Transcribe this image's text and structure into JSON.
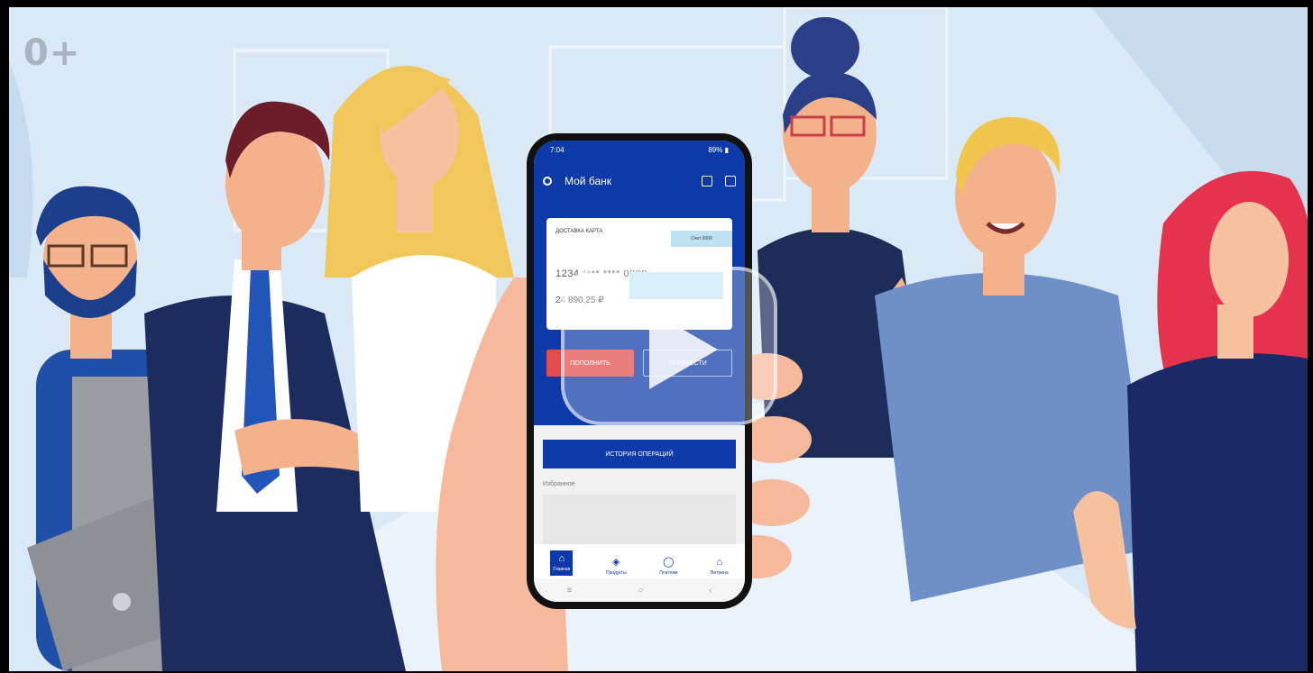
{
  "video": {
    "age_rating": "0+",
    "play_icon": "play-icon"
  },
  "phone": {
    "status_time": "7:04",
    "status_battery": "89% ▮",
    "app_title": "Мой банк",
    "card": {
      "type": "ДОСТАВКА КАРТА",
      "account": "Счет 0000",
      "number": "1234 **** **** 0000",
      "balance": "24 890,25 ₽"
    },
    "topup_label": "ПОПОЛНИТЬ",
    "transfer_label": "ПЕРЕВЕСТИ",
    "history_label": "ИСТОРИЯ ОПЕРАЦИЙ",
    "favorites_label": "Избранное",
    "nav": [
      {
        "label": "Главная",
        "icon": "home-icon",
        "glyph": "⌂"
      },
      {
        "label": "Продукты",
        "icon": "cube-icon",
        "glyph": "◈"
      },
      {
        "label": "Платежи",
        "icon": "payments-icon",
        "glyph": "◯"
      },
      {
        "label": "Витрина",
        "icon": "bag-icon",
        "glyph": "⌂"
      }
    ]
  },
  "colors": {
    "bank_blue": "#0d3aa8",
    "accent_red": "#e34c4c",
    "background": "#d9e8f5"
  }
}
